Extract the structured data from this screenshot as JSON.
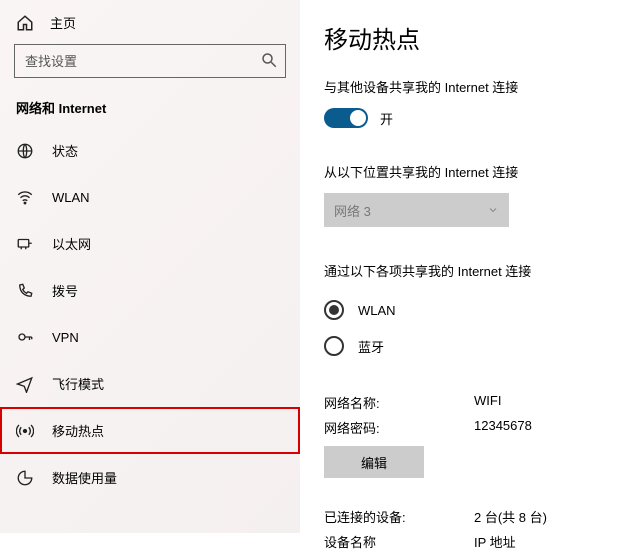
{
  "home": "主页",
  "searchPlaceholder": "查找设置",
  "category": "网络和 Internet",
  "nav": {
    "status": "状态",
    "wlan": "WLAN",
    "ethernet": "以太网",
    "dialup": "拨号",
    "vpn": "VPN",
    "airplane": "飞行模式",
    "hotspot": "移动热点",
    "datausage": "数据使用量"
  },
  "title": "移动热点",
  "shareLabel": "与其他设备共享我的 Internet 连接",
  "toggleText": "开",
  "shareFromLabel": "从以下位置共享我的 Internet 连接",
  "shareFromValue": "网络 3",
  "shareWithLabel": "通过以下各项共享我的 Internet 连接",
  "radioWlan": "WLAN",
  "radioBt": "蓝牙",
  "netNameLabel": "网络名称:",
  "netNameValue": "WIFI",
  "netPassLabel": "网络密码:",
  "netPassValue": "12345678",
  "editBtn": "编辑",
  "connectedLabel": "已连接的设备:",
  "connectedValue": "2 台(共 8 台)",
  "deviceNameHeader": "设备名称",
  "ipHeader": "IP 地址"
}
